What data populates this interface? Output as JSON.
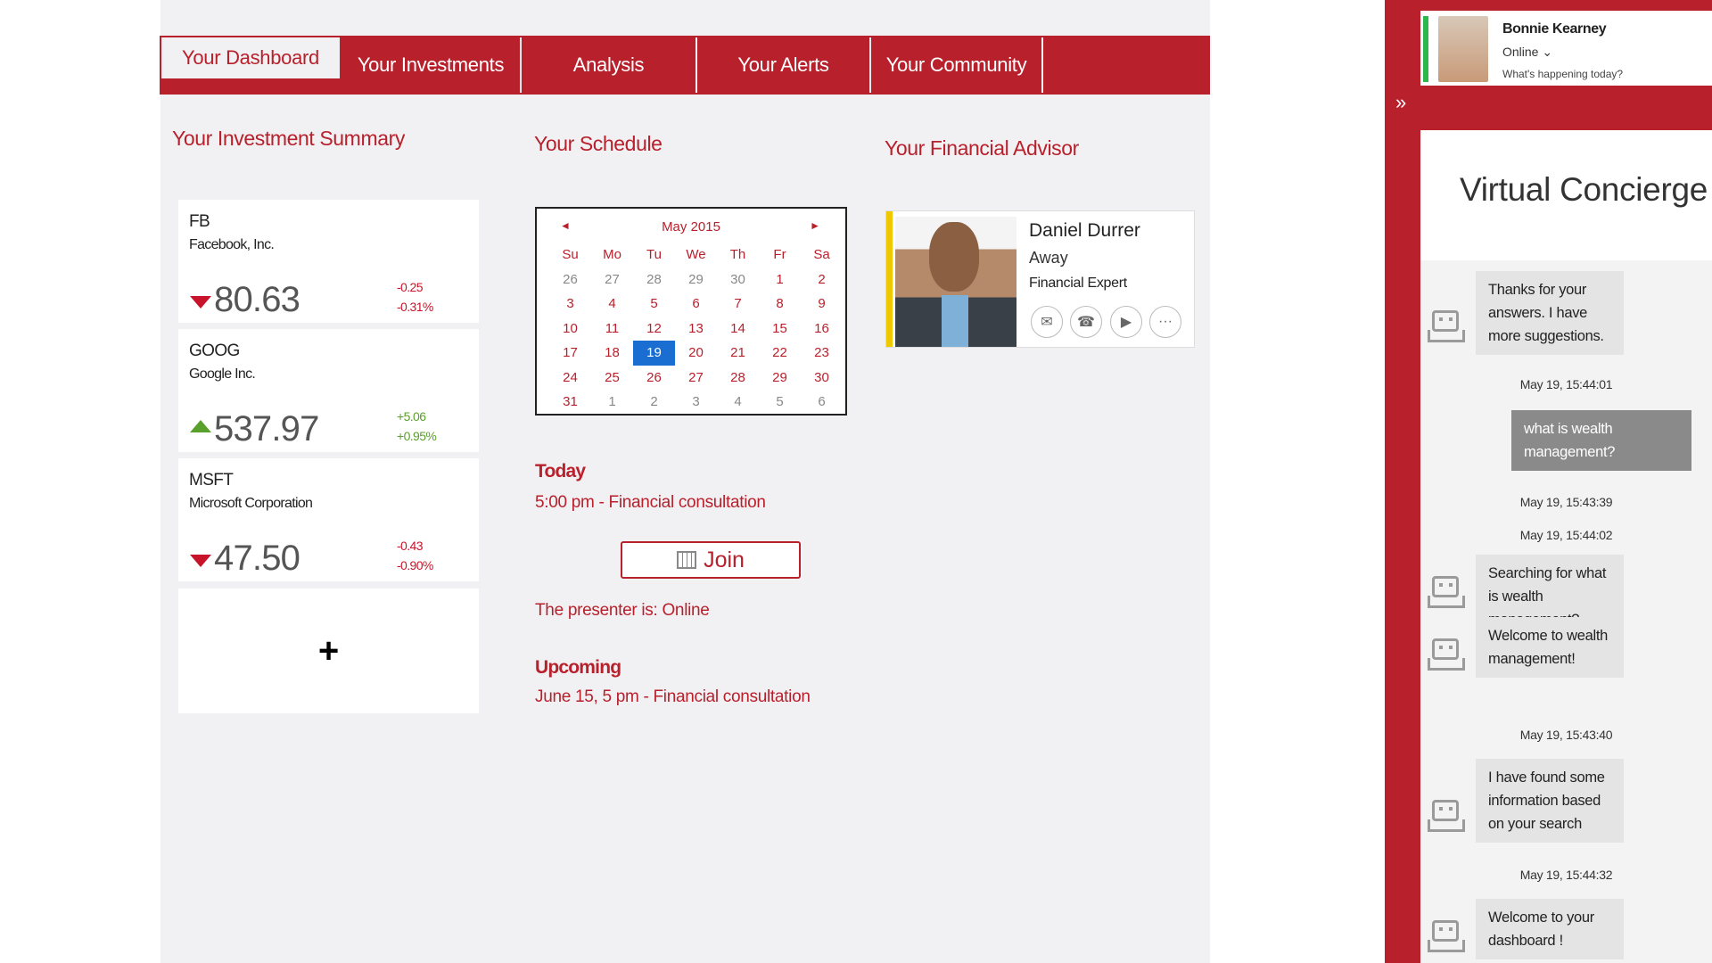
{
  "tabs": [
    "Your Dashboard",
    "Your Investments",
    "Analysis",
    "Your Alerts",
    "Your Community"
  ],
  "sections": {
    "investment_summary": "Your Investment Summary",
    "schedule": "Your Schedule",
    "advisor": "Your Financial Advisor"
  },
  "stocks": [
    {
      "symbol": "FB",
      "name": "Facebook, Inc.",
      "price": "80.63",
      "change": "-0.25",
      "change_pct": "-0.31%",
      "direction": "down"
    },
    {
      "symbol": "GOOG",
      "name": "Google Inc.",
      "price": "537.97",
      "change": "+5.06",
      "change_pct": "+0.95%",
      "direction": "up"
    },
    {
      "symbol": "MSFT",
      "name": "Microsoft Corporation",
      "price": "47.50",
      "change": "-0.43",
      "change_pct": "-0.90%",
      "direction": "down"
    }
  ],
  "add_card": {
    "label": "+"
  },
  "calendar": {
    "month": "May 2015",
    "prev": "◄",
    "next": "►",
    "days_of_week": [
      "Su",
      "Mo",
      "Tu",
      "We",
      "Th",
      "Fr",
      "Sa"
    ],
    "weeks": [
      [
        "26",
        "27",
        "28",
        "29",
        "30",
        "1",
        "2"
      ],
      [
        "3",
        "4",
        "5",
        "6",
        "7",
        "8",
        "9"
      ],
      [
        "10",
        "11",
        "12",
        "13",
        "14",
        "15",
        "16"
      ],
      [
        "17",
        "18",
        "19",
        "20",
        "21",
        "22",
        "23"
      ],
      [
        "24",
        "25",
        "26",
        "27",
        "28",
        "29",
        "30"
      ],
      [
        "31",
        "1",
        "2",
        "3",
        "4",
        "5",
        "6"
      ]
    ],
    "selected": "19"
  },
  "schedule": {
    "today_label": "Today",
    "today_event": "5:00 pm - Financial consultation",
    "join_label": "Join",
    "presenter": "The presenter is: Online",
    "upcoming_label": "Upcoming",
    "upcoming_event": "June 15, 5 pm - Financial consultation"
  },
  "advisor": {
    "name": "Daniel Durrer",
    "status": "Away",
    "role": "Financial Expert",
    "presence_color": "#f0c800"
  },
  "user": {
    "name": "Bonnie Kearney",
    "status": "Online",
    "prompt": "What's happening today?",
    "presence_color": "#2db84d"
  },
  "concierge": {
    "title": "Virtual Concierge",
    "messages": [
      {
        "from": "bot",
        "text": "Thanks for your answers. I have more suggestions."
      },
      {
        "from": "time",
        "text": "May 19, 15:44:01"
      },
      {
        "from": "me",
        "text": "what is wealth management?"
      },
      {
        "from": "time",
        "text": "May 19, 15:43:39"
      },
      {
        "from": "time",
        "text": "May 19, 15:44:02"
      },
      {
        "from": "bot",
        "text": "Searching for what is wealth management?"
      },
      {
        "from": "bot",
        "text": "Welcome to wealth management!"
      },
      {
        "from": "time",
        "text": "May 19, 15:43:40"
      },
      {
        "from": "bot",
        "text": "I have found some information based on your search"
      },
      {
        "from": "time",
        "text": "May 19, 15:44:32"
      },
      {
        "from": "bot",
        "text": "Welcome to your dashboard !"
      }
    ]
  },
  "colors": {
    "accent": "#b8202c",
    "selected_day": "#1a6ed1",
    "positive": "#5aa02c",
    "negative": "#c8142a"
  }
}
